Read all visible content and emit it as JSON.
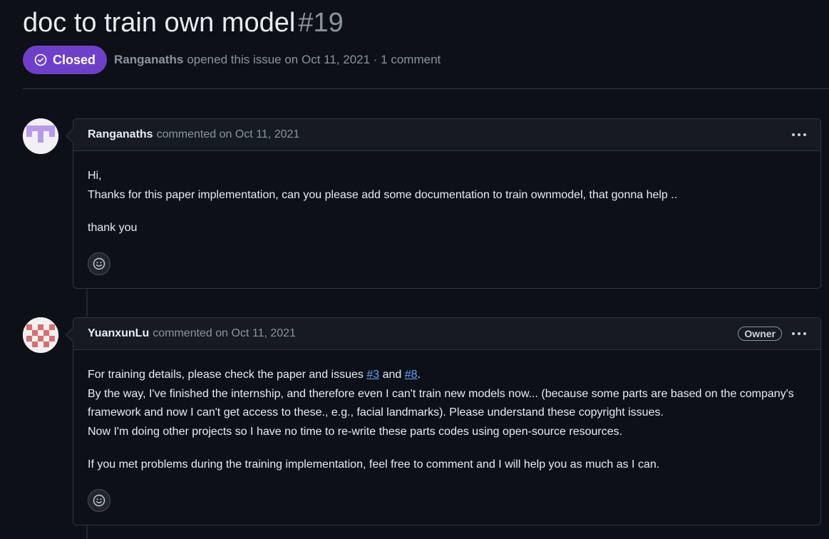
{
  "issue": {
    "title": "doc to train own model",
    "number": "#19",
    "state": "Closed",
    "author": "Ranganaths",
    "opened_text": "opened this issue on Oct 11, 2021 · 1 comment"
  },
  "comments": [
    {
      "author": "Ranganaths",
      "action": "commented on Oct 11, 2021",
      "lines": [
        "Hi,",
        "Thanks for this paper implementation, can you please add some documentation to train ownmodel, that gonna help ..",
        "thank you"
      ]
    },
    {
      "author": "YuanxunLu",
      "action": "commented on Oct 11, 2021",
      "badge": "Owner",
      "p1_pre": "For training details, please check the paper and issues ",
      "link1": "#3",
      "p1_mid": " and ",
      "link2": "#8",
      "p1_post": ".",
      "line2": "By the way, I've finished the internship, and therefore even I can't train new models now... (because some parts are based on the company's framework and now I can't get access to these., e.g., facial landmarks). Please understand these copyright issues.",
      "line3": "Now I'm doing other projects so I have no time to re-write these parts codes using open-source resources.",
      "p2": "If you met problems during the training implementation, feel free to comment and I will help you as much as I can."
    }
  ],
  "colors": {
    "background": "#0d1117",
    "closed_badge": "#6e40c9",
    "link": "#58a6ff"
  },
  "icons": [
    "closed-circle-icon",
    "kebab-icon",
    "smiley-icon"
  ]
}
